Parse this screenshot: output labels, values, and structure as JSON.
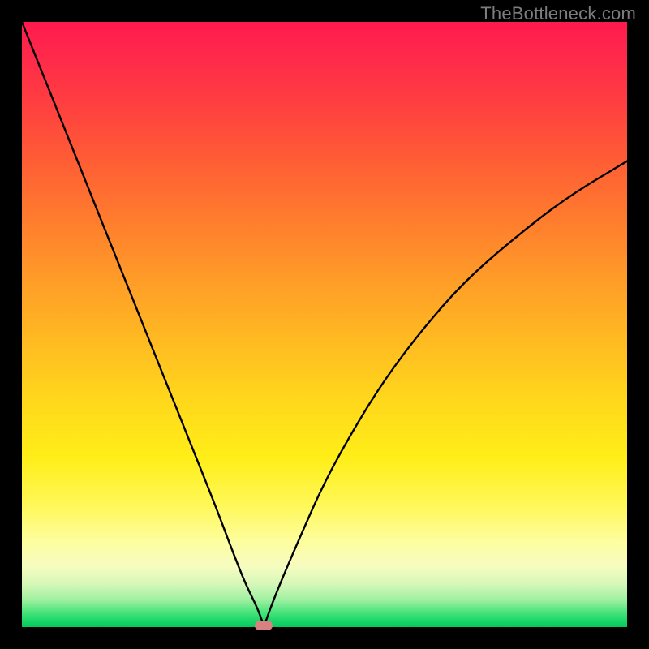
{
  "watermark": "TheBottleneck.com",
  "chart_data": {
    "type": "line",
    "title": "",
    "xlabel": "",
    "ylabel": "",
    "xlim": [
      0,
      100
    ],
    "ylim": [
      0,
      100
    ],
    "grid": false,
    "legend": false,
    "marker": {
      "x": 40,
      "y": 0
    },
    "series": [
      {
        "name": "bottleneck-curve",
        "x": [
          0,
          4,
          8,
          12,
          16,
          20,
          24,
          28,
          32,
          35,
          37,
          39,
          40,
          41,
          43,
          46,
          50,
          55,
          60,
          66,
          73,
          81,
          90,
          100
        ],
        "values": [
          100,
          90,
          80,
          70,
          60,
          50,
          40,
          30,
          20,
          12,
          7,
          3,
          0,
          3,
          8,
          15,
          24,
          33,
          41,
          49,
          57,
          64,
          71,
          77
        ]
      }
    ]
  }
}
